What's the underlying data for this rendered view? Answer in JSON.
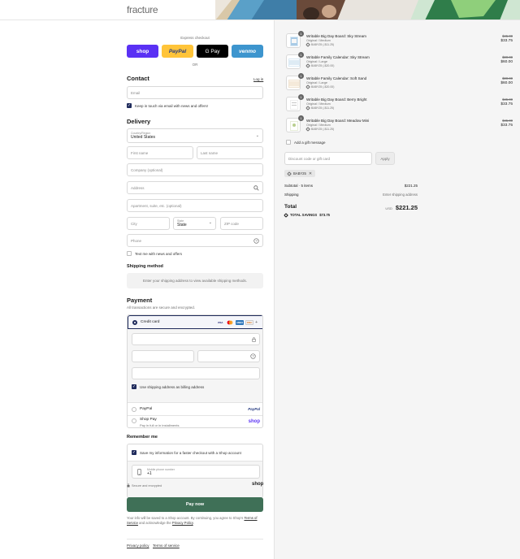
{
  "brand": {
    "logo_text": "fracture"
  },
  "express": {
    "label": "Express checkout",
    "buttons": {
      "shop": "shop",
      "paypal": "PayPal",
      "gpay": "G Pay",
      "venmo": "venmo"
    },
    "or": "OR"
  },
  "contact": {
    "title": "Contact",
    "login_link": "Log in",
    "email_placeholder": "Email",
    "news_label": "Keep in touch via email with news and offers!"
  },
  "delivery": {
    "title": "Delivery",
    "country_label": "Country/Region",
    "country_value": "United States",
    "first_name": "First name",
    "last_name": "Last name",
    "company": "Company (optional)",
    "address": "Address",
    "apartment": "Apartment, suite, etc. (optional)",
    "city": "City",
    "state_label": "State",
    "state_value": "State",
    "zip": "ZIP code",
    "phone": "Phone",
    "text_label": "Text me with news and offers"
  },
  "shipping": {
    "title": "Shipping method",
    "info": "Enter your shipping address to view available shipping methods."
  },
  "payment": {
    "title": "Payment",
    "subtitle": "All transactions are secure and encrypted.",
    "credit_card": "Credit card",
    "card_brands": {
      "visa": "VISA",
      "mastercard": "MC",
      "amex": "AMEX",
      "discover": "DISC"
    },
    "billing_label": "Use shipping address as billing address",
    "paypal": "PayPal",
    "paypal_logo": "PayPal",
    "shoppay": "Shop Pay",
    "shoppay_sub": "Pay in full or in installments",
    "shoppay_logo": "shop"
  },
  "remember": {
    "title": "Remember me",
    "save_label": "Save my information for a faster checkout with a Shop account",
    "phone_label": "Mobile phone number",
    "phone_value": "+1",
    "secure_label": "Secure and encrypted",
    "shop_logo": "shop"
  },
  "pay_now": "Pay now",
  "legal": {
    "text_1": "Your info will be saved to a Shop account. By continuing, you agree to Shop's",
    "terms": "Terms of Service",
    "text_2": "and acknowledge the",
    "privacy": "Privacy Policy",
    "period": "."
  },
  "footer": {
    "privacy": "Privacy policy",
    "terms": "Terms of service"
  },
  "cart": {
    "items": [
      {
        "qty": "1",
        "title": "Writable Big Day Board: Sky Stream",
        "variant": "Original / Medium",
        "discount": "BABY25 (-$11.25)",
        "old_price": "$45.00",
        "new_price": "$33.75"
      },
      {
        "qty": "1",
        "title": "Writable Family Calendar: Sky Stream",
        "variant": "Original / Large",
        "discount": "BABY25 (-$20.00)",
        "old_price": "$80.00",
        "new_price": "$60.00"
      },
      {
        "qty": "1",
        "title": "Writable Family Calendar: Soft Sand",
        "variant": "Original / Large",
        "discount": "BABY25 (-$20.00)",
        "old_price": "$80.00",
        "new_price": "$60.00"
      },
      {
        "qty": "1",
        "title": "Writable Big Day Board: Berry Bright",
        "variant": "Original / Medium",
        "discount": "BABY25 (-$11.25)",
        "old_price": "$45.00",
        "new_price": "$33.75"
      },
      {
        "qty": "1",
        "title": "Writable Big Day Board: Meadow Mini",
        "variant": "Original / Medium",
        "discount": "BABY25 (-$11.25)",
        "old_price": "$45.00",
        "new_price": "$33.75"
      }
    ],
    "gift_label": "Add a gift message",
    "discount_placeholder": "Discount code or gift card",
    "apply": "Apply",
    "applied_code": "BABY25",
    "subtotal_label": "Subtotal · 5 items",
    "subtotal_value": "$221.25",
    "shipping_label": "Shipping",
    "shipping_value": "Enter shipping address",
    "total_label": "Total",
    "currency": "USD",
    "total_value": "$221.25",
    "savings_label": "TOTAL SAVINGS",
    "savings_value": "$73.75"
  }
}
